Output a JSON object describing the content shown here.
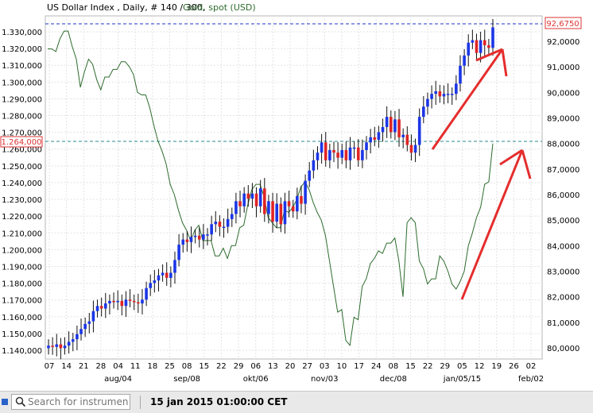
{
  "chart_data": {
    "type": "candlestick+line",
    "title": "US Dollar Index , Daily, # 140 / 300,",
    "title_series2": "Gold, spot (USD)",
    "left_axis": {
      "min": 1140000,
      "max": 1330000,
      "step": 10000,
      "ticks": [
        "1.330,000",
        "1.320,000",
        "1.310,000",
        "1.300,000",
        "1.290,000",
        "1.280,000",
        "1.270,000",
        "1.260,000",
        "1.250,000",
        "1.240,000",
        "1.230,000",
        "1.220,000",
        "1.210,000",
        "1.200,000",
        "1.190,000",
        "1.180,000",
        "1.170,000",
        "1.160,000",
        "1.150,000",
        "1.140,000"
      ]
    },
    "right_axis": {
      "min": 80,
      "max": 92,
      "ticks": [
        "92,0000",
        "91,0000",
        "90,0000",
        "89,0000",
        "88,0000",
        "87,0000",
        "86,0000",
        "85,0000",
        "84,0000",
        "83,0000",
        "82,0000",
        "81,0000",
        "80,0000"
      ]
    },
    "x_day_labels": [
      "07",
      "14",
      "21",
      "28",
      "04",
      "11",
      "18",
      "25",
      "08",
      "15",
      "22",
      "29",
      "06",
      "13",
      "20",
      "27",
      "03",
      "10",
      "17",
      "24",
      "08",
      "15",
      "22",
      "29",
      "05",
      "12",
      "19",
      "26",
      "02"
    ],
    "x_month_labels": [
      "aug/04",
      "sep/08",
      "okt/06",
      "nov/03",
      "dec/08",
      "jan/05/15",
      "feb/02"
    ],
    "current_left_label": "1.264,000",
    "current_left_value": 1264000,
    "current_right_label": "92,6750",
    "current_right_value": 92.675,
    "usd_index_closes": [
      80.05,
      80.0,
      80.1,
      79.95,
      80.05,
      80.2,
      80.3,
      80.5,
      80.7,
      80.9,
      81.0,
      81.4,
      81.6,
      81.5,
      81.7,
      81.8,
      81.75,
      81.8,
      81.6,
      81.85,
      81.8,
      81.75,
      81.7,
      81.85,
      82.3,
      82.5,
      82.6,
      82.8,
      82.9,
      82.7,
      82.9,
      83.4,
      84.0,
      84.2,
      84.1,
      84.3,
      84.35,
      84.2,
      84.4,
      84.4,
      84.8,
      84.9,
      84.7,
      84.7,
      85.0,
      85.2,
      85.7,
      85.5,
      86.0,
      85.8,
      86.0,
      85.5,
      86.2,
      85.2,
      85.7,
      84.9,
      85.6,
      84.8,
      85.7,
      85.5,
      85.3,
      85.9,
      85.6,
      86.5,
      86.9,
      87.3,
      87.6,
      88.0,
      87.3,
      87.7,
      87.6,
      87.4,
      87.7,
      87.3,
      87.8,
      87.8,
      87.3,
      87.7,
      88.0,
      88.2,
      88.1,
      88.4,
      88.6,
      89.0,
      88.4,
      88.9,
      88.2,
      88.3,
      87.9,
      87.6,
      87.9,
      89.0,
      89.4,
      89.7,
      89.9,
      90.0,
      89.8,
      89.9,
      89.9,
      89.9,
      90.3,
      91.0,
      91.4,
      91.9,
      92.0,
      91.5,
      92.0,
      91.8,
      91.7,
      92.5
    ],
    "gold_series_right_axis": [
      91.7,
      91.7,
      91.6,
      92.1,
      92.4,
      92.4,
      91.8,
      91.3,
      90.2,
      90.8,
      91.3,
      91.1,
      90.5,
      90.1,
      90.6,
      90.6,
      90.9,
      90.9,
      91.2,
      91.2,
      91.0,
      90.7,
      90.0,
      89.9,
      89.9,
      89.4,
      88.7,
      88.1,
      87.7,
      87.2,
      86.4,
      86.0,
      85.4,
      84.9,
      84.6,
      84.2,
      84.6,
      84.8,
      84.2,
      84.2,
      84.2,
      83.6,
      83.6,
      83.9,
      83.5,
      84.0,
      84.0,
      84.7,
      84.8,
      85.6,
      86.2,
      86.4,
      86.4,
      85.9,
      85.1,
      84.9,
      84.7,
      84.7,
      85.4,
      85.3,
      85.5,
      85.8,
      86.3,
      86.5,
      86.2,
      85.7,
      85.3,
      85.0,
      84.4,
      83.4,
      82.4,
      81.4,
      81.5,
      80.3,
      80.1,
      81.2,
      81.1,
      82.4,
      82.7,
      83.3,
      83.5,
      83.8,
      83.7,
      84.1,
      84.1,
      84.3,
      83.4,
      82.0,
      84.9,
      85.1,
      84.9,
      83.4,
      83.1,
      82.5,
      82.7,
      82.7,
      83.6,
      83.4,
      83.0,
      82.5,
      82.3,
      82.6,
      83.0,
      84.0,
      84.5,
      85.1,
      85.5,
      86.4,
      86.5,
      88.0
    ],
    "annotations": [
      {
        "type": "arrow",
        "color": "#e52d2d",
        "from": [
          0.78,
          0.73
        ],
        "to": [
          0.92,
          0.6
        ],
        "desc": "upper trend arrow"
      },
      {
        "type": "arrow",
        "color": "#e52d2d",
        "from": [
          0.74,
          0.65
        ],
        "to": [
          0.9,
          0.3
        ],
        "desc": "lower trend arrow"
      }
    ],
    "grid": true,
    "colors": {
      "up": "#1b36e6",
      "down": "#e02424",
      "gold_line": "#2d6b2d",
      "dashed_line": "#1c34c8",
      "marker_line": "#2a8a8a",
      "annotation": "#e52d2d"
    }
  },
  "status_bar": {
    "search_placeholder": "Search for instrument",
    "date": "15 jan 2015 01:00:00 CET"
  }
}
